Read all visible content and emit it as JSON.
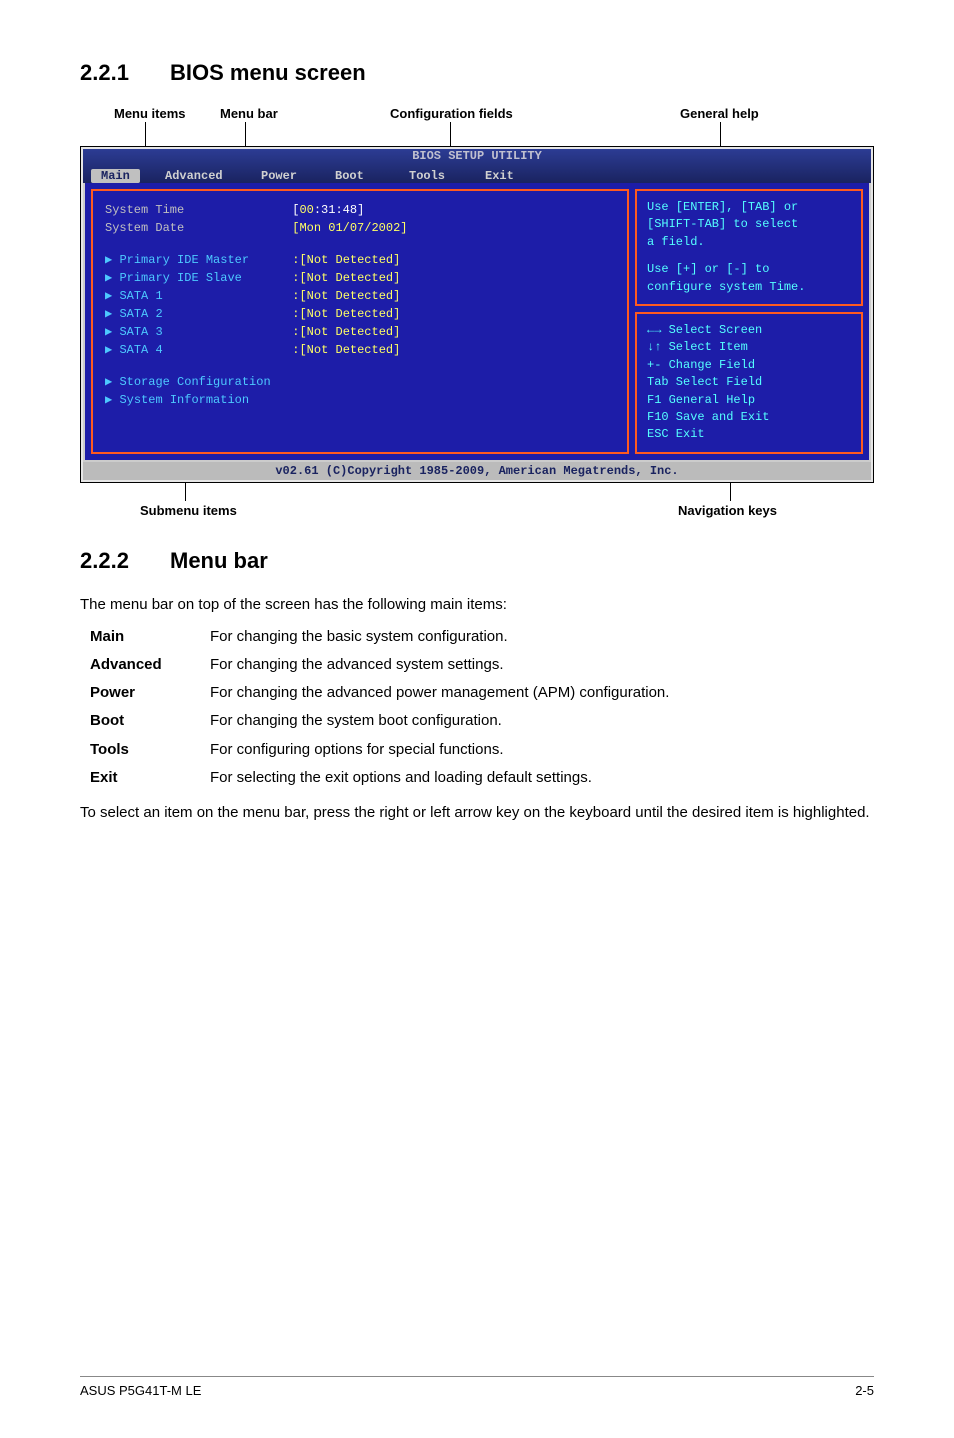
{
  "section1_num": "2.2.1",
  "section1_title": "BIOS menu screen",
  "anno_top": {
    "menu_items": "Menu items",
    "menu_bar": "Menu bar",
    "config_fields": "Configuration fields",
    "general_help": "General help"
  },
  "bios": {
    "title": "BIOS SETUP UTILITY",
    "tabs": [
      "Main",
      "Advanced",
      "Power",
      "Boot",
      "Tools",
      "Exit"
    ],
    "rows": {
      "sys_time_label": "System Time",
      "sys_time_value": "[00:31:48]",
      "sys_date_label": "System Date",
      "sys_date_value": "[Mon 01/07/2002]",
      "pim": "Primary IDE Master",
      "pim_v": ":[Not Detected]",
      "pis": "Primary IDE Slave",
      "pis_v": ":[Not Detected]",
      "s1": "SATA 1",
      "s1_v": ":[Not Detected]",
      "s2": "SATA 2",
      "s2_v": ":[Not Detected]",
      "s3": "SATA 3",
      "s3_v": ":[Not Detected]",
      "s4": "SATA 4",
      "s4_v": ":[Not Detected]",
      "storage": "Storage Configuration",
      "sysinfo": "System Information"
    },
    "help1_l1": "Use [ENTER], [TAB] or",
    "help1_l2": "[SHIFT-TAB] to select",
    "help1_l3": "a field.",
    "help1_l4": "Use [+] or [-] to",
    "help1_l5": "configure system Time.",
    "nav": {
      "l1": "←→   Select Screen",
      "l2": "↓↑   Select Item",
      "l3": "+-   Change Field",
      "l4": "Tab  Select Field",
      "l5": "F1   General Help",
      "l6": "F10  Save and Exit",
      "l7": "ESC  Exit"
    },
    "copyright": "v02.61 (C)Copyright 1985-2009, American Megatrends, Inc."
  },
  "anno_bottom": {
    "submenu": "Submenu items",
    "navkeys": "Navigation keys"
  },
  "section2_num": "2.2.2",
  "section2_title": "Menu bar",
  "intro": "The menu bar on top of the screen has the following main items:",
  "items": {
    "Main": "For changing the basic system configuration.",
    "Advanced": "For changing the advanced system settings.",
    "Power": "For changing the advanced power management (APM) configuration.",
    "Boot": "For changing the system boot configuration.",
    "Tools": "For configuring options for special functions.",
    "Exit": "For selecting the exit options and loading default settings."
  },
  "outro": "To select an item on the menu bar, press the right or left arrow key on the keyboard until the desired item is highlighted.",
  "footer_left": "ASUS P5G41T-M LE",
  "footer_right": "2-5"
}
